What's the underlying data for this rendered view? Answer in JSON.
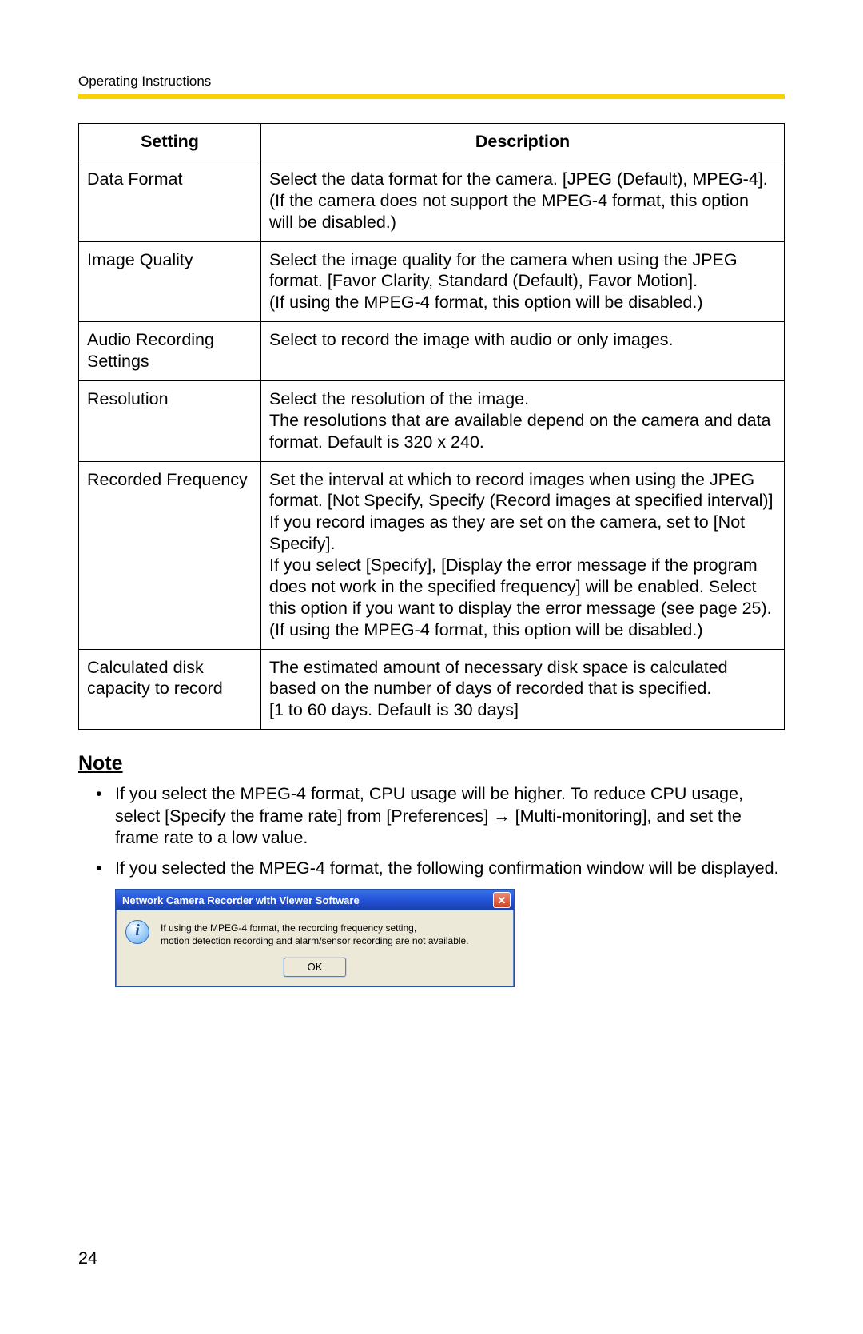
{
  "header": {
    "text": "Operating Instructions"
  },
  "table": {
    "headers": {
      "setting": "Setting",
      "description": "Description"
    },
    "rows": [
      {
        "setting": "Data Format",
        "description": "Select the data format for the camera. [JPEG (Default), MPEG-4]. (If the camera does not support the MPEG-4 format, this option will be disabled.)"
      },
      {
        "setting": "Image Quality",
        "description": "Select the image quality for the camera when using the JPEG format. [Favor Clarity, Standard (Default), Favor Motion].\n(If using the MPEG-4 format, this option will be disabled.)"
      },
      {
        "setting": "Audio Recording Settings",
        "description": "Select to record the image with audio or only images."
      },
      {
        "setting": "Resolution",
        "description": "Select the resolution of the image.\nThe resolutions that are available depend on the camera and data format. Default is 320 x 240."
      },
      {
        "setting": "Recorded Frequency",
        "description": "Set the interval at which to record images when using the JPEG format. [Not Specify, Specify (Record images at specified interval)]\nIf you record images as they are set on the camera, set to [Not Specify].\nIf you select [Specify], [Display the error message if the program does not work in the specified frequency] will be enabled. Select this option if you want to display the error message (see page 25).\n(If using the MPEG-4 format, this option will be disabled.)"
      },
      {
        "setting": "Calculated disk capacity to record",
        "description": "The estimated amount of necessary disk space is calculated based on the number of days of recorded that is specified.\n[1 to 60 days. Default is 30 days]"
      }
    ]
  },
  "note": {
    "heading": "Note",
    "items": [
      "If you select the MPEG-4 format, CPU usage will be higher. To reduce CPU usage, select [Specify the frame rate] from [Preferences] → [Multi-monitoring], and set the frame rate to a low value.",
      "If you selected the MPEG-4 format, the following confirmation window will be displayed."
    ]
  },
  "dialog": {
    "title": "Network Camera Recorder with Viewer Software",
    "message": "If using the MPEG-4 format, the recording frequency setting,\nmotion detection recording and alarm/sensor recording are not available.",
    "ok": "OK",
    "close": "✕"
  },
  "page_number": "24"
}
